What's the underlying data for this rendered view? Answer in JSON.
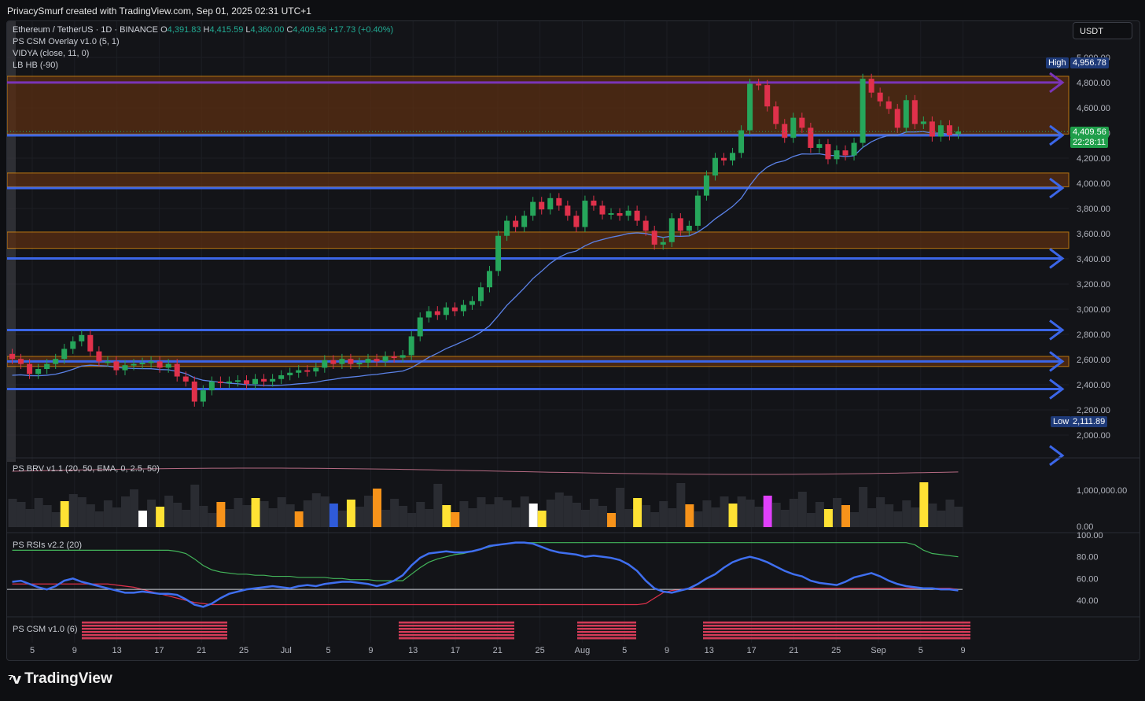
{
  "caption": "PrivacySmurf created with TradingView.com, Sep 01, 2025 02:31 UTC+1",
  "footer_brand": "TradingView",
  "currency_button": "USDT",
  "legend": {
    "symbol": "Ethereum / TetherUS · 1D · BINANCE",
    "o_label": "O",
    "o_value": "4,391.83",
    "h_label": "H",
    "h_value": "4,415.59",
    "l_label": "L",
    "l_value": "4,360.00",
    "c_label": "C",
    "c_value": "4,409.56",
    "change": "+17.73 (+0.40%)",
    "indicators": [
      "PS CSM Overlay v1.0 (5, 1)",
      "VIDYA (close, 11, 0)",
      "LB HB (-90)"
    ]
  },
  "price_tags": {
    "high_label": "High",
    "high_value": "4,956.78",
    "low_label": "Low",
    "low_value": "2,111.89",
    "last_price": "4,409.56",
    "countdown": "22:28:11"
  },
  "pane_labels": {
    "brv": "PS BRV v1.1 (20, 50, EMA, 0, 2.5, 50)",
    "rsi": "PS RSIs v2.2 (20)",
    "csm": "PS CSM v1.0 (6)"
  },
  "colors": {
    "up": "#26a65b",
    "down": "#e0314b",
    "blue_level": "#3b66e8",
    "purple_level": "#7a34b8",
    "zone_fill": "#5a2e12",
    "zone_border": "#f0960f",
    "vidya": "#5b82e8"
  },
  "chart_data": {
    "type": "candlestick",
    "title": "Ethereum / TetherUS · 1D · BINANCE",
    "price_axis": {
      "ticks": [
        "5,000.00",
        "4,800.00",
        "4,600.00",
        "4,400.00",
        "4,200.00",
        "4,000.00",
        "3,800.00",
        "3,600.00",
        "3,400.00",
        "3,200.00",
        "3,000.00",
        "2,800.00",
        "2,600.00",
        "2,400.00",
        "2,200.00",
        "2,000.00"
      ],
      "ylim": [
        1850,
        5100
      ]
    },
    "time_axis": {
      "ticks": [
        "5",
        "9",
        "13",
        "17",
        "21",
        "25",
        "Jul",
        "5",
        "9",
        "13",
        "17",
        "21",
        "25",
        "Aug",
        "5",
        "9",
        "13",
        "17",
        "21",
        "25",
        "Sep",
        "5",
        "9"
      ]
    },
    "close": [
      2600,
      2560,
      2480,
      2520,
      2560,
      2600,
      2680,
      2740,
      2790,
      2660,
      2580,
      2580,
      2510,
      2550,
      2560,
      2570,
      2580,
      2530,
      2560,
      2460,
      2420,
      2260,
      2350,
      2420,
      2410,
      2420,
      2430,
      2400,
      2440,
      2420,
      2440,
      2470,
      2490,
      2510,
      2500,
      2530,
      2590,
      2560,
      2600,
      2560,
      2570,
      2600,
      2580,
      2620,
      2610,
      2630,
      2780,
      2930,
      2980,
      2950,
      3010,
      2980,
      3030,
      3060,
      3170,
      3300,
      3580,
      3700,
      3650,
      3740,
      3850,
      3790,
      3880,
      3820,
      3740,
      3650,
      3860,
      3820,
      3750,
      3760,
      3740,
      3780,
      3700,
      3620,
      3510,
      3530,
      3720,
      3620,
      3660,
      3900,
      4060,
      4200,
      4180,
      4240,
      4420,
      4790,
      4780,
      4610,
      4470,
      4360,
      4520,
      4440,
      4280,
      4310,
      4190,
      4260,
      4220,
      4320,
      4830,
      4720,
      4650,
      4590,
      4440,
      4660,
      4470,
      4490,
      4370,
      4460,
      4380,
      4410
    ],
    "open": [
      2640,
      2600,
      2560,
      2480,
      2520,
      2560,
      2600,
      2680,
      2740,
      2790,
      2660,
      2580,
      2580,
      2510,
      2550,
      2560,
      2570,
      2580,
      2530,
      2560,
      2460,
      2420,
      2260,
      2350,
      2420,
      2410,
      2420,
      2430,
      2400,
      2440,
      2420,
      2440,
      2470,
      2490,
      2510,
      2500,
      2530,
      2590,
      2560,
      2600,
      2560,
      2570,
      2600,
      2580,
      2620,
      2610,
      2630,
      2780,
      2930,
      2980,
      2950,
      3010,
      2980,
      3030,
      3060,
      3170,
      3300,
      3580,
      3700,
      3650,
      3740,
      3850,
      3790,
      3880,
      3820,
      3740,
      3650,
      3860,
      3820,
      3750,
      3760,
      3740,
      3780,
      3700,
      3620,
      3510,
      3530,
      3720,
      3620,
      3660,
      3900,
      4060,
      4200,
      4180,
      4240,
      4420,
      4790,
      4780,
      4610,
      4470,
      4360,
      4520,
      4440,
      4280,
      4310,
      4190,
      4260,
      4220,
      4320,
      4830,
      4720,
      4650,
      4590,
      4440,
      4660,
      4470,
      4490,
      4370,
      4460,
      4392
    ],
    "high_low_note": "wicks approximated",
    "levels_blue": [
      4380,
      3960,
      3400,
      2830,
      2580,
      2360
    ],
    "level_purple": 4800,
    "zones": [
      [
        4390,
        4850
      ],
      [
        3970,
        4080
      ],
      [
        3480,
        3610
      ],
      [
        2540,
        2620
      ]
    ],
    "brv_axis": {
      "ticks": [
        "1,000,000.00",
        "0.00"
      ]
    },
    "rsi_axis": {
      "ticks": [
        "100.00",
        "80.00",
        "60.00",
        "40.00"
      ]
    },
    "rsi_line": [
      57,
      58,
      55,
      52,
      50,
      53,
      58,
      60,
      57,
      55,
      53,
      51,
      49,
      47,
      47,
      48,
      47,
      46,
      46,
      45,
      41,
      36,
      34,
      37,
      42,
      46,
      48,
      50,
      51,
      52,
      53,
      52,
      51,
      53,
      54,
      53,
      55,
      56,
      57,
      57,
      56,
      55,
      53,
      55,
      58,
      63,
      72,
      79,
      83,
      84,
      85,
      84,
      84,
      85,
      87,
      90,
      91,
      92,
      93,
      93,
      92,
      89,
      86,
      84,
      83,
      82,
      80,
      81,
      80,
      79,
      77,
      73,
      67,
      58,
      51,
      48,
      47,
      49,
      51,
      55,
      60,
      64,
      70,
      75,
      78,
      80,
      78,
      75,
      71,
      67,
      64,
      62,
      58,
      56,
      55,
      54,
      57,
      61,
      63,
      65,
      62,
      58,
      55,
      53,
      52,
      51,
      51,
      50,
      50,
      49
    ],
    "rsi_upper": [
      86,
      86,
      86,
      86,
      86,
      86,
      86,
      86,
      86,
      86,
      86,
      86,
      86,
      86,
      86,
      86,
      86,
      86,
      86,
      85,
      83,
      78,
      72,
      68,
      66,
      65,
      64,
      64,
      63,
      63,
      62,
      62,
      62,
      61,
      61,
      61,
      61,
      60,
      60,
      59,
      59,
      59,
      58,
      58,
      58,
      58,
      64,
      70,
      75,
      78,
      80,
      82,
      83,
      85,
      87,
      89,
      91,
      92,
      93,
      93,
      93,
      93,
      93,
      93,
      93,
      93,
      93,
      93,
      93,
      93,
      93,
      93,
      93,
      93,
      93,
      93,
      93,
      93,
      93,
      93,
      93,
      93,
      93,
      93,
      93,
      93,
      93,
      93,
      93,
      93,
      93,
      93,
      93,
      93,
      93,
      93,
      93,
      93,
      93,
      93,
      93,
      93,
      93,
      93,
      91,
      86,
      83,
      82,
      81,
      80
    ],
    "rsi_lower": [
      55,
      55,
      55,
      55,
      55,
      55,
      55,
      55,
      55,
      55,
      55,
      55,
      54,
      53,
      52,
      50,
      48,
      46,
      44,
      42,
      40,
      38,
      37,
      36,
      36,
      36,
      36,
      36,
      36,
      36,
      36,
      36,
      36,
      36,
      36,
      36,
      36,
      36,
      36,
      36,
      36,
      36,
      36,
      36,
      36,
      36,
      36,
      36,
      36,
      36,
      36,
      36,
      36,
      36,
      36,
      36,
      36,
      36,
      36,
      36,
      36,
      36,
      36,
      36,
      36,
      36,
      36,
      36,
      36,
      36,
      36,
      36,
      36,
      37,
      42,
      47,
      49,
      50,
      51,
      51,
      51,
      51,
      51,
      51,
      51,
      51,
      51,
      51,
      51,
      51,
      51,
      51,
      51,
      51,
      51,
      51,
      51,
      51,
      51,
      51,
      51,
      51,
      51,
      51,
      51,
      51,
      51,
      51,
      51,
      50
    ],
    "rsi_mid": 50
  }
}
